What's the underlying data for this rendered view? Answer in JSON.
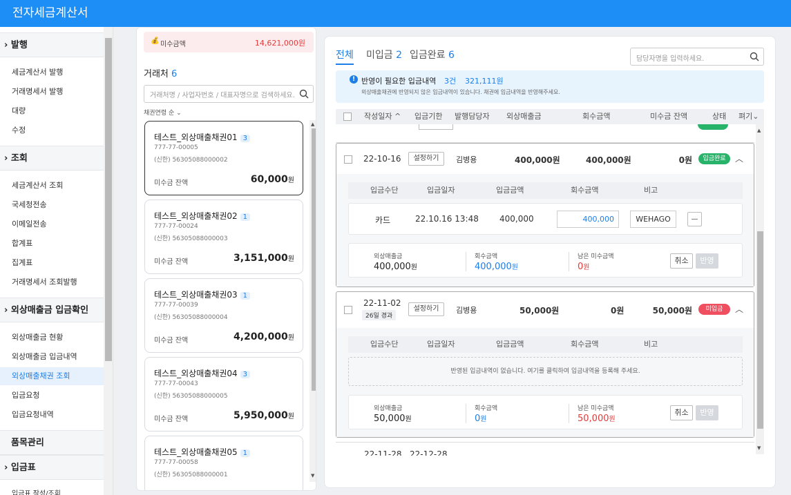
{
  "app": {
    "title": "전자세금계산서"
  },
  "sidebar": {
    "sections": [
      {
        "label": "발행",
        "items": [
          "세금계산서 발행",
          "거래명세서 발행",
          "대량",
          "수정"
        ]
      },
      {
        "label": "조회",
        "items": [
          "세금계산서 조회",
          "국세청전송",
          "이메일전송",
          "합계표",
          "집계표",
          "거래명세서 조회발행"
        ]
      },
      {
        "label": "외상매출금 입금확인",
        "items": [
          "외상매출금 현황",
          "외상매출금 입금내역",
          "외상매출채권 조회",
          "입금요청",
          "입금요청내역"
        ]
      },
      {
        "label": "품목관리",
        "items": []
      },
      {
        "label": "입금표",
        "items": []
      }
    ],
    "active_item": "외상매출채권 조회",
    "cut_off_text": "입금표 작성/조회"
  },
  "mid": {
    "unpaid_label": "미수금액",
    "unpaid_amount": "14,621,000원",
    "title": "거래처",
    "count": "6",
    "search_placeholder": "거래처명 / 사업자번호 / 대표자명으로 검색하세요.",
    "sort_label": "채권연령 순",
    "cards": [
      {
        "name": "테스트_외상매출채권01",
        "badge": "3",
        "regno": "777-77-00005",
        "bank": "(신한) 56305088000002",
        "balance_label": "미수금 잔액",
        "amount": "60,000",
        "unit": "원"
      },
      {
        "name": "테스트_외상매출채권02",
        "badge": "1",
        "regno": "777-77-00024",
        "bank": "(신한) 56305088000003",
        "balance_label": "미수금 잔액",
        "amount": "3,151,000",
        "unit": "원"
      },
      {
        "name": "테스트_외상매출채권03",
        "badge": "1",
        "regno": "777-77-00039",
        "bank": "(신한) 56305088000004",
        "balance_label": "미수금 잔액",
        "amount": "4,200,000",
        "unit": "원"
      },
      {
        "name": "테스트_외상매출채권04",
        "badge": "3",
        "regno": "777-77-00043",
        "bank": "(신한) 56305088000005",
        "balance_label": "미수금 잔액",
        "amount": "5,950,000",
        "unit": "원"
      },
      {
        "name": "테스트_외상매출채권05",
        "badge": "1",
        "regno": "777-77-00058",
        "bank": "(신한) 56305088000001",
        "balance_label": "미수금 잔액",
        "amount": "",
        "unit": ""
      }
    ]
  },
  "right": {
    "tabs": [
      {
        "label": "전체",
        "count": ""
      },
      {
        "label": "미입금",
        "count": "2"
      },
      {
        "label": "입금완료",
        "count": "6"
      }
    ],
    "manager_placeholder": "담당자명을 입력하세요.",
    "notice": {
      "title": "반영이 필요한 입금내역",
      "count": "3건",
      "amount": "321,111원",
      "desc": "외상매출채권에 반영되지 않은 입금내역이 있습니다. 채권에 입금내역을 반영해주세요."
    },
    "columns": [
      "작성일자 ^",
      "입금기한",
      "발행담당자",
      "외상매출금",
      "회수금액",
      "미수금 잔액",
      "상태",
      "펴기"
    ],
    "sub_columns": [
      "입금수단",
      "입금일자",
      "입금금액",
      "회수금액",
      "비고"
    ],
    "rows": [
      {
        "date": "22-10-16",
        "elapsed": "",
        "set_btn": "설정하기",
        "manager": "김병용",
        "sales": "400,000원",
        "collected": "400,000원",
        "balance": "0원",
        "status": "입금완료",
        "status_color": "#27b36a",
        "deposits": [
          {
            "method": "카드",
            "date": "22.10.16 13:48",
            "amount": "400,000",
            "collect_input": "400,000",
            "note": "WEHAGO",
            "minus": "—"
          }
        ],
        "empty_msg": "",
        "sum": {
          "sales_label": "외상매출금",
          "sales": "400,000",
          "collected_label": "회수금액",
          "collected": "400,000",
          "remain_label": "남은 미수금액",
          "remain": "0",
          "unit": "원",
          "cancel": "취소",
          "apply": "반영"
        }
      },
      {
        "date": "22-11-02",
        "elapsed": "26일 경과",
        "set_btn": "설정하기",
        "manager": "김병용",
        "sales": "50,000원",
        "collected": "0원",
        "balance": "50,000원",
        "status": "미입금",
        "status_color": "#ef4f5f",
        "deposits": [],
        "empty_msg": "반영된 입금내역이 없습니다. 여기를 클릭하여 입금내역을 등록해 주세요.",
        "sum": {
          "sales_label": "외상매출금",
          "sales": "50,000",
          "collected_label": "회수금액",
          "collected": "0",
          "remain_label": "남은 미수금액",
          "remain": "50,000",
          "unit": "원",
          "cancel": "취소",
          "apply": "반영"
        }
      }
    ],
    "next_row_partial": {
      "date": "22-11-28",
      "due": "22-12-28"
    }
  }
}
